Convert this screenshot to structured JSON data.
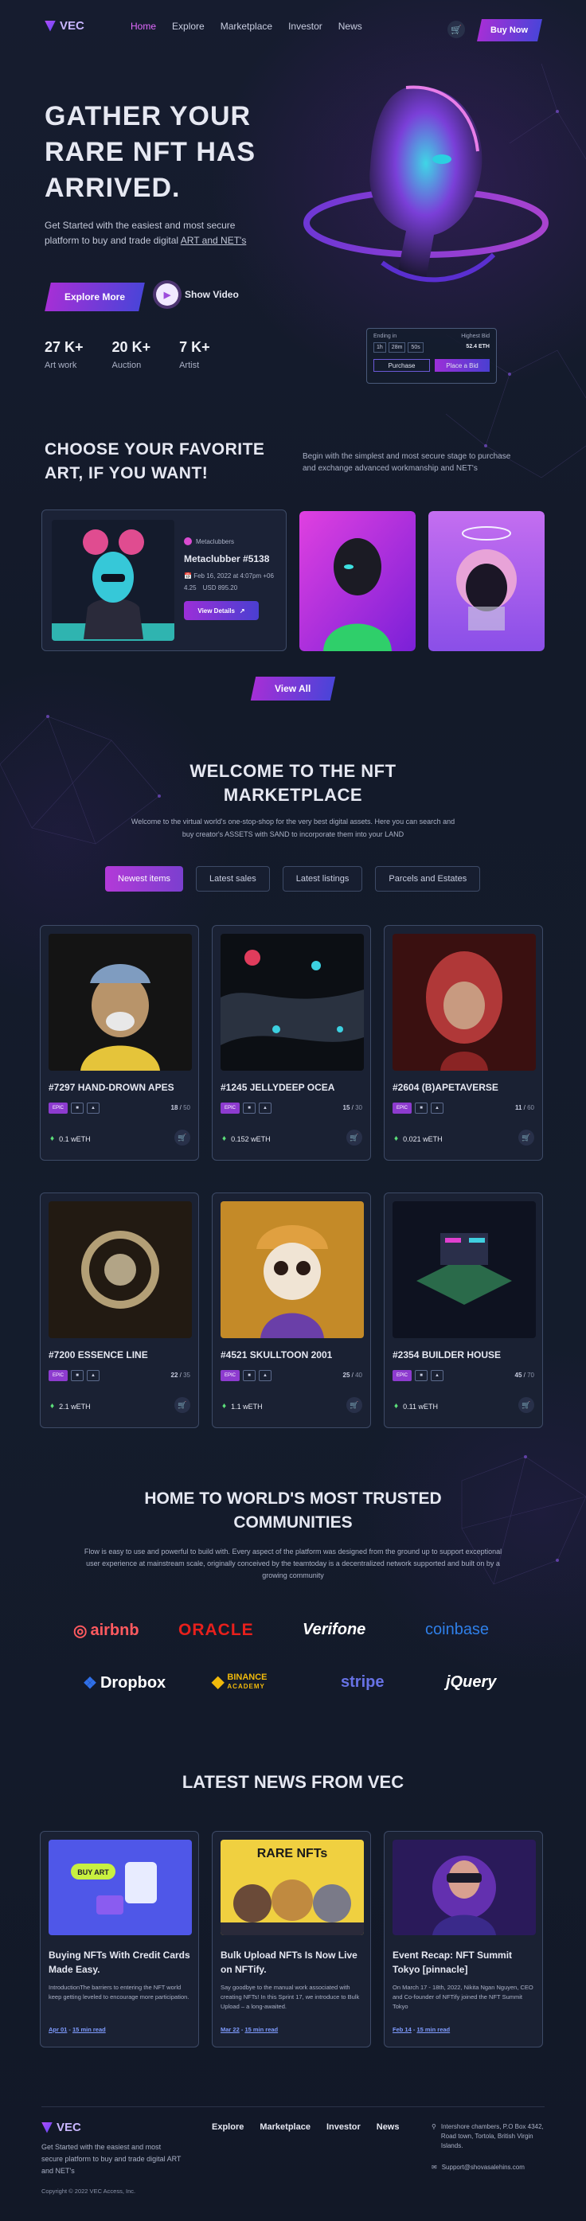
{
  "header": {
    "logo": "VEC",
    "nav": [
      "Home",
      "Explore",
      "Marketplace",
      "Investor",
      "News"
    ],
    "buy_now": "Buy Now"
  },
  "hero": {
    "title": "GATHER YOUR RARE NFT HAS ARRIVED.",
    "subtitle": "Get Started with the easiest and most secure platform to buy and trade digital",
    "subtitle_link": "ART and NET's",
    "explore": "Explore More",
    "watch": "Show Video",
    "stats": [
      {
        "num": "27 K+",
        "label": "Art work"
      },
      {
        "num": "20 K+",
        "label": "Auction"
      },
      {
        "num": "7 K+",
        "label": "Artist"
      }
    ],
    "bid": {
      "ending_label": "Ending in",
      "highest_label": "Highest Bid",
      "times": [
        "1h",
        "28m",
        "50s"
      ],
      "eth": "52.4 ETH",
      "purchase": "Purchase",
      "place_bid": "Place a Bid"
    }
  },
  "choose": {
    "title": "CHOOSE YOUR FAVORITE ART, IF YOU WANT!",
    "desc": "Begin with the simplest and most secure stage to purchase and exchange advanced workmanship and NET's",
    "featured": {
      "owner": "Metaclubbers",
      "name": "Metaclubber #5138",
      "date": "Feb 16, 2022 at 4:07pm +06",
      "rating": "4.25",
      "price": "USD 895.20",
      "cta": "View Details"
    },
    "view_all": "View All"
  },
  "welcome": {
    "title": "WELCOME TO THE NFT MARKETPLACE",
    "desc": "Welcome to the virtual world's one-stop-shop for the very best digital assets. Here you can search and buy creator's ASSETS with SAND to incorporate them into your LAND",
    "tabs": [
      "Newest items",
      "Latest sales",
      "Latest listings",
      "Parcels and Estates"
    ]
  },
  "items": [
    {
      "title": "#7297 HAND-DROWN APES",
      "tag": "EPIC",
      "count": "18",
      "total": "50",
      "price": "0.1 wETH"
    },
    {
      "title": "#1245 JELLYDEEP OCEA",
      "tag": "EPIC",
      "count": "15",
      "total": "30",
      "price": "0.152 wETH"
    },
    {
      "title": "#2604 (B)APETAVERSE",
      "tag": "EPIC",
      "count": "11",
      "total": "60",
      "price": "0.021 wETH"
    },
    {
      "title": "#7200 ESSENCE LINE",
      "tag": "EPIC",
      "count": "22",
      "total": "35",
      "price": "2.1 wETH"
    },
    {
      "title": "#4521 SKULLTOON 2001",
      "tag": "EPIC",
      "count": "25",
      "total": "40",
      "price": "1.1 wETH"
    },
    {
      "title": "#2354 BUILDER HOUSE",
      "tag": "EPIC",
      "count": "45",
      "total": "70",
      "price": "0.11 wETH"
    }
  ],
  "communities": {
    "title": "HOME TO WORLD'S MOST TRUSTED COMMUNITIES",
    "desc": "Flow is easy to use and powerful to build with. Every aspect of the platform was designed from the ground up to support exceptional user experience at mainstream scale, originally conceived by the teamtoday is a decentralized network supported and built on by a growing community",
    "logos": [
      "airbnb",
      "ORACLE",
      "Verifone",
      "coinbase",
      "Dropbox",
      "BINANCE",
      "ACADEMY",
      "stripe",
      "jQuery"
    ]
  },
  "news": {
    "title": "LATEST NEWS FROM VEC",
    "posts": [
      {
        "title": "Buying NFTs With Credit Cards Made Easy.",
        "body": "IntroductionThe barriers to entering the NFT world keep getting leveled to encourage more participation.",
        "date": "Apr 01",
        "read": "15 min read",
        "img_text": "BUY ART"
      },
      {
        "title": "Bulk Upload NFTs Is Now Live on NFTify.",
        "body": "Say goodbye to the manual work associated with creating NFTs! In this Sprint 17, we introduce to Bulk Upload – a long-awaited.",
        "date": "Mar 22",
        "read": "15 min read",
        "img_text": "RARE NFTs"
      },
      {
        "title": "Event Recap: NFT Summit Tokyo [pinnacle]",
        "body": "On March 17 - 18th, 2022, Nikita Ngan Nguyen, CEO and Co-founder of NFTify joined the NFT Summit Tokyo",
        "date": "Feb 14",
        "read": "15 min read",
        "img_text": ""
      }
    ]
  },
  "footer": {
    "logo": "VEC",
    "desc": "Get Started with the easiest and most secure platform to buy and trade digital ART and NET's",
    "copyright": "Copyright © 2022 VEC Access, Inc.",
    "nav": [
      "Explore",
      "Marketplace",
      "Investor",
      "News"
    ],
    "address": "Intershore chambers, P.O Box 4342, Road town, Tortola, British Virgin Islands.",
    "email": "Support@shovasalehins.com"
  },
  "colors": {
    "accent_purple": "#9b2fd8",
    "accent_blue": "#4a3fd1",
    "bg": "#141a2b",
    "eth_green": "#5ce07a"
  }
}
